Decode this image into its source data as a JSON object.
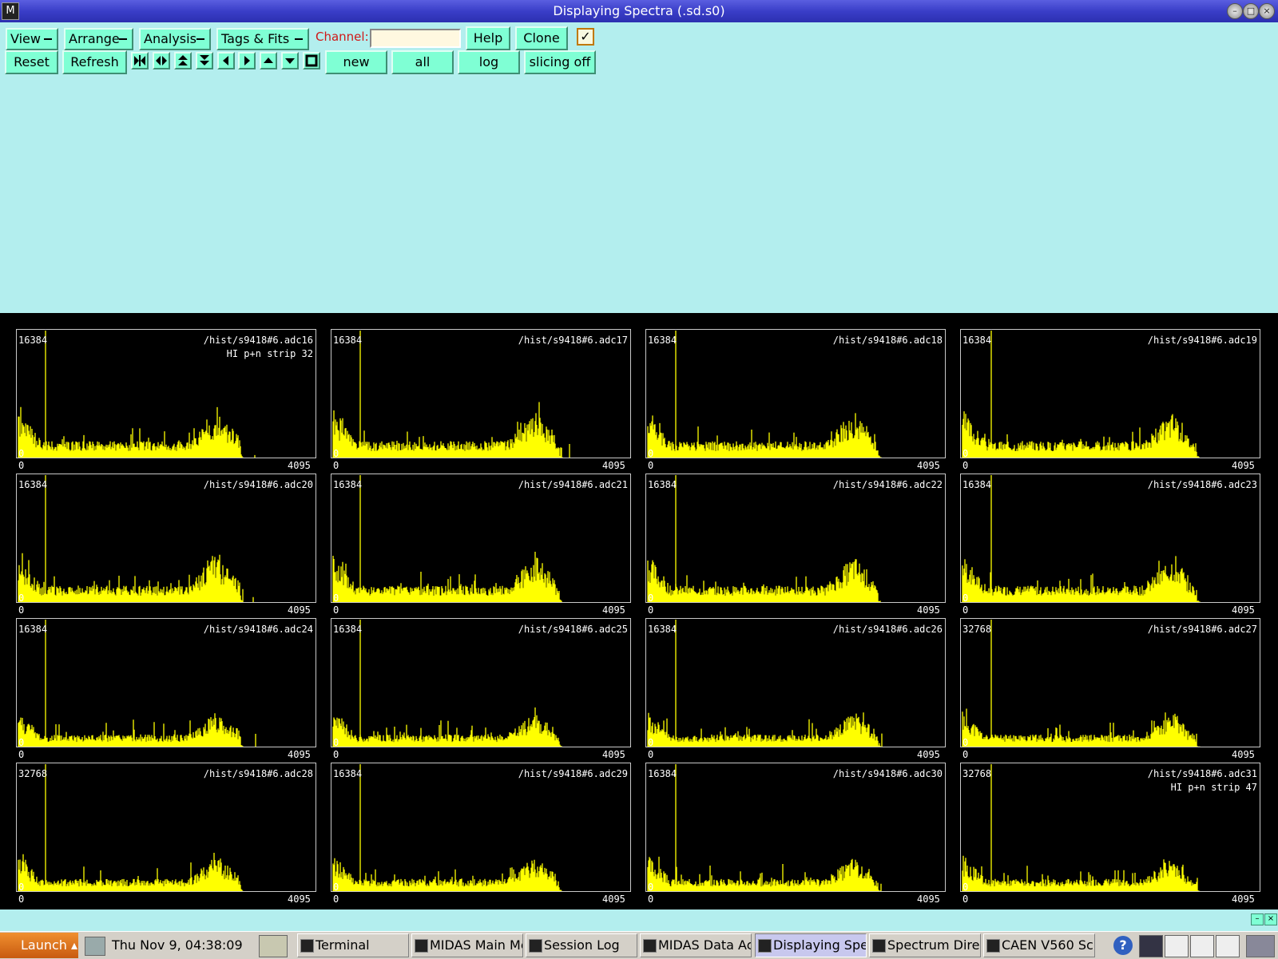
{
  "window": {
    "title": "Displaying Spectra (.sd.s0)"
  },
  "menus": [
    "View",
    "Arrange",
    "Analysis",
    "Tags & Fits"
  ],
  "channel": {
    "label": "Channel:",
    "value": ""
  },
  "buttons": {
    "help": "Help",
    "clone": "Clone",
    "reset": "Reset",
    "refresh": "Refresh",
    "new": "new",
    "all": "all",
    "log": "log",
    "slicing": "slicing off"
  },
  "nav_icons": [
    "expand-horizontal-icon",
    "shrink-horizontal-icon",
    "expand-vertical-icon",
    "shrink-vertical-icon",
    "left-arrow-icon",
    "right-arrow-icon",
    "up-arrow-icon",
    "down-arrow-icon",
    "square-icon"
  ],
  "spectrum_color": "#ffff00",
  "panels": [
    {
      "name": "/hist/s9418#6.adc16",
      "ymax": "16384",
      "sub": "HI p+n strip 32",
      "xmin": "0",
      "xmax": "4095"
    },
    {
      "name": "/hist/s9418#6.adc17",
      "ymax": "16384",
      "sub": "",
      "xmin": "0",
      "xmax": "4095"
    },
    {
      "name": "/hist/s9418#6.adc18",
      "ymax": "16384",
      "sub": "",
      "xmin": "0",
      "xmax": "4095"
    },
    {
      "name": "/hist/s9418#6.adc19",
      "ymax": "16384",
      "sub": "",
      "xmin": "0",
      "xmax": "4095"
    },
    {
      "name": "/hist/s9418#6.adc20",
      "ymax": "16384",
      "sub": "",
      "xmin": "0",
      "xmax": "4095"
    },
    {
      "name": "/hist/s9418#6.adc21",
      "ymax": "16384",
      "sub": "",
      "xmin": "0",
      "xmax": "4095"
    },
    {
      "name": "/hist/s9418#6.adc22",
      "ymax": "16384",
      "sub": "",
      "xmin": "0",
      "xmax": "4095"
    },
    {
      "name": "/hist/s9418#6.adc23",
      "ymax": "16384",
      "sub": "",
      "xmin": "0",
      "xmax": "4095"
    },
    {
      "name": "/hist/s9418#6.adc24",
      "ymax": "16384",
      "sub": "",
      "xmin": "0",
      "xmax": "4095"
    },
    {
      "name": "/hist/s9418#6.adc25",
      "ymax": "16384",
      "sub": "",
      "xmin": "0",
      "xmax": "4095"
    },
    {
      "name": "/hist/s9418#6.adc26",
      "ymax": "16384",
      "sub": "",
      "xmin": "0",
      "xmax": "4095"
    },
    {
      "name": "/hist/s9418#6.adc27",
      "ymax": "32768",
      "sub": "",
      "xmin": "0",
      "xmax": "4095"
    },
    {
      "name": "/hist/s9418#6.adc28",
      "ymax": "32768",
      "sub": "",
      "xmin": "0",
      "xmax": "4095"
    },
    {
      "name": "/hist/s9418#6.adc29",
      "ymax": "16384",
      "sub": "",
      "xmin": "0",
      "xmax": "4095"
    },
    {
      "name": "/hist/s9418#6.adc30",
      "ymax": "16384",
      "sub": "",
      "xmin": "0",
      "xmax": "4095"
    },
    {
      "name": "/hist/s9418#6.adc31",
      "ymax": "32768",
      "sub": "HI p+n strip 47",
      "xmin": "0",
      "xmax": "4095"
    }
  ],
  "taskbar": {
    "launch": "Launch",
    "clock": "Thu Nov  9, 04:38:09",
    "tasks": [
      "Terminal",
      "MIDAS Main Me",
      "Session Log",
      "MIDAS Data Ac",
      "Displaying Spe",
      "Spectrum Direc",
      "CAEN V560 Sc"
    ]
  }
}
